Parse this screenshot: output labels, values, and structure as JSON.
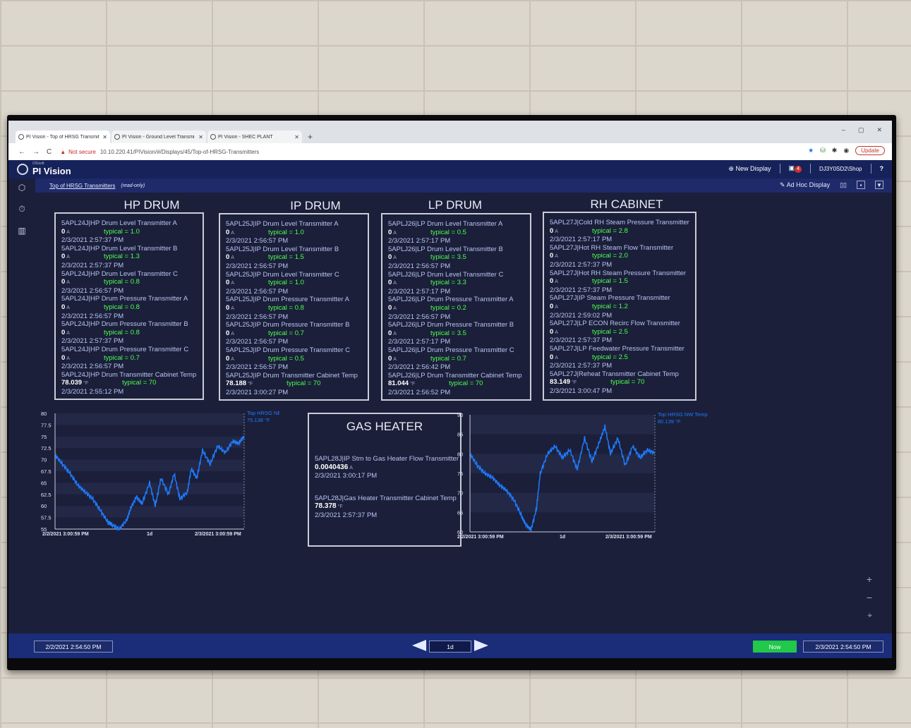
{
  "browser": {
    "tabs": [
      {
        "label": "PI Vision - Top of HRSG Transmit"
      },
      {
        "label": "PI Vision - Ground Level Transmi"
      },
      {
        "label": "PI Vision - SHEC PLANT"
      }
    ],
    "new_tab": "+",
    "warning": "Not secure",
    "url": "10.10.220.41/PIVision/#/Displays/45/Top-of-HRSG-Transmitters",
    "update_label": "Update"
  },
  "app": {
    "vendor": "OSIsoft",
    "name": "PI Vision",
    "new_display": "New Display",
    "notification_count": "4",
    "user": "DJ3Y0SD2\\Shop",
    "help": "?"
  },
  "subheader": {
    "display_name": "Top of HRSG Transmitters",
    "mode": "(read-only)",
    "adhoc": "Ad Hoc Display"
  },
  "sections": [
    {
      "title": "HP DRUM",
      "items": [
        {
          "name": "5APL24J|HP Drum Level Transmitter A",
          "value": "0",
          "unit": "A",
          "typical": "typical = 1.0",
          "time": "2/3/2021 2:57:37 PM"
        },
        {
          "name": "5APL24J|HP Drum Level Transmitter B",
          "value": "0",
          "unit": "A",
          "typical": "typical = 1.3",
          "time": "2/3/2021 2:57:37 PM"
        },
        {
          "name": "5APL24J|HP Drum Level Transmitter C",
          "value": "0",
          "unit": "A",
          "typical": "typical = 0.8",
          "time": "2/3/2021 2:56:57 PM"
        },
        {
          "name": "5APL24J|HP Drum Pressure Transmitter A",
          "value": "0",
          "unit": "A",
          "typical": "typical = 0.8",
          "time": "2/3/2021 2:56:57 PM"
        },
        {
          "name": "5APL24J|HP Drum Pressure Transmitter B",
          "value": "0",
          "unit": "A",
          "typical": "typical = 0.8",
          "time": "2/3/2021 2:57:37 PM"
        },
        {
          "name": "5APL24J|HP Drum Pressure Transmitter C",
          "value": "0",
          "unit": "A",
          "typical": "typical = 0.7",
          "time": "2/3/2021 2:56:57 PM"
        },
        {
          "name": "5APL24J|HP Drum Transmitter Cabinet Temp",
          "value": "78.039",
          "unit": "°F",
          "typical": "typical = 70",
          "time": "2/3/2021 2:55:12 PM"
        }
      ]
    },
    {
      "title": "IP DRUM",
      "items": [
        {
          "name": "5APL25J|IP Drum Level Transmitter A",
          "value": "0",
          "unit": "A",
          "typical": "typical = 1.0",
          "time": "2/3/2021 2:56:57 PM"
        },
        {
          "name": "5APL25J|IP Drum Level Transmitter B",
          "value": "0",
          "unit": "A",
          "typical": "typical = 1.5",
          "time": "2/3/2021 2:56:57 PM"
        },
        {
          "name": "5APL25J|IP Drum Level Transmitter C",
          "value": "0",
          "unit": "A",
          "typical": "typical = 1.0",
          "time": "2/3/2021 2:56:57 PM"
        },
        {
          "name": "5APL25J|IP Drum Pressure Transmitter A",
          "value": "0",
          "unit": "A",
          "typical": "typical = 0.8",
          "time": "2/3/2021 2:56:57 PM"
        },
        {
          "name": "5APL25J|IP Drum Pressure Transmitter B",
          "value": "0",
          "unit": "A",
          "typical": "typical = 0.7",
          "time": "2/3/2021 2:56:57 PM"
        },
        {
          "name": "5APL25J|IP Drum Pressure Transmitter C",
          "value": "0",
          "unit": "A",
          "typical": "typical = 0.5",
          "time": "2/3/2021 2:56:57 PM"
        },
        {
          "name": "5APL25J|IP Drum Transmitter Cabinet Temp",
          "value": "78.188",
          "unit": "°F",
          "typical": "typical = 70",
          "time": "2/3/2021 3:00:27 PM"
        }
      ]
    },
    {
      "title": "LP DRUM",
      "items": [
        {
          "name": "5APLJ26|LP Drum Level Transmitter A",
          "value": "0",
          "unit": "A",
          "typical": "typical = 0.5",
          "time": "2/3/2021 2:57:17 PM"
        },
        {
          "name": "5APLJ26|LP Drum Level Transmitter B",
          "value": "0",
          "unit": "A",
          "typical": "typical = 3.5",
          "time": "2/3/2021 2:56:57 PM"
        },
        {
          "name": "5APLJ26|LP Drum Level Transmitter C",
          "value": "0",
          "unit": "A",
          "typical": "typical = 3.3",
          "time": "2/3/2021 2:57:17 PM"
        },
        {
          "name": "5APLJ26|LP Drum Pressure Transmitter A",
          "value": "0",
          "unit": "A",
          "typical": "typical = 0.2",
          "time": "2/3/2021 2:56:57 PM"
        },
        {
          "name": "5APLJ26|LP Drum Pressure Transmitter B",
          "value": "0",
          "unit": "A",
          "typical": "typical = 3.5",
          "time": "2/3/2021 2:57:17 PM"
        },
        {
          "name": "5APLJ26|LP Drum Pressure Transmitter C",
          "value": "0",
          "unit": "A",
          "typical": "typical = 0.7",
          "time": "2/3/2021 2:56:42 PM"
        },
        {
          "name": "5APLJ26|LP Drum Transmitter Cabinet Temp",
          "value": "81.044",
          "unit": "°F",
          "typical": "typical = 70",
          "time": "2/3/2021 2:56:52 PM"
        }
      ]
    },
    {
      "title": "RH CABINET",
      "items": [
        {
          "name": "5APL27J|Cold RH Steam Pressure Transmitter",
          "value": "0",
          "unit": "A",
          "typical": "typical = 2.8",
          "time": "2/3/2021 2:57:17 PM"
        },
        {
          "name": "5APL27J|Hot RH Steam Flow Transmitter",
          "value": "0",
          "unit": "A",
          "typical": "typical = 2.0",
          "time": "2/3/2021 2:57:37 PM"
        },
        {
          "name": "5APL27J|Hot RH Steam Pressure Transmitter",
          "value": "0",
          "unit": "A",
          "typical": "typical = 1.5",
          "time": "2/3/2021 2:57:37 PM"
        },
        {
          "name": "5APL27J|IP Steam Pressure Transmitter",
          "value": "0",
          "unit": "A",
          "typical": "typical = 1.2",
          "time": "2/3/2021 2:59:02 PM"
        },
        {
          "name": "5APL27J|LP ECON Recirc Flow Transmitter",
          "value": "0",
          "unit": "A",
          "typical": "typical = 2.5",
          "time": "2/3/2021 2:57:37 PM"
        },
        {
          "name": "5APL27J|LP Feedwater Pressure Transmitter",
          "value": "0",
          "unit": "A",
          "typical": "typical = 2.5",
          "time": "2/3/2021 2:57:37 PM"
        },
        {
          "name": "5APL27J|Reheat Transmitter Cabinet Temp",
          "value": "83.149",
          "unit": "°F",
          "typical": "typical = 70",
          "time": "2/3/2021 3:00:47 PM"
        }
      ]
    }
  ],
  "gas_heater": {
    "title": "GAS HEATER",
    "items": [
      {
        "name": "5APL28J|IP Stm to Gas Heater Flow Transmitter",
        "value": "0.0040436",
        "unit": "A",
        "time": "2/3/2021 3:00:17 PM"
      },
      {
        "name": "5APL28J|Gas Heater Transmitter Cabinet Temp",
        "value": "78.378",
        "unit": "°F",
        "time": "2/3/2021 2:57:37 PM"
      }
    ]
  },
  "chart_data": [
    {
      "type": "line",
      "legend": "Top HRSG NE Temp",
      "current": "75.138 °F",
      "color": "#1e7bff",
      "yticks": [
        "80",
        "77.5",
        "75",
        "72.5",
        "70",
        "67.5",
        "65",
        "62.5",
        "60",
        "57.5",
        "55"
      ],
      "ylim": [
        55,
        80
      ],
      "xticks": [
        "2/2/2021 3:00:59 PM",
        "1d",
        "2/3/2021 3:00:59 PM"
      ],
      "x": [
        0,
        0.04,
        0.08,
        0.12,
        0.16,
        0.2,
        0.24,
        0.28,
        0.3,
        0.34,
        0.38,
        0.4,
        0.43,
        0.46,
        0.5,
        0.53,
        0.56,
        0.6,
        0.63,
        0.66,
        0.7,
        0.72,
        0.75,
        0.78,
        0.82,
        0.86,
        0.9,
        0.94,
        0.97,
        1.0
      ],
      "values": [
        71,
        69,
        67,
        64.5,
        63,
        61.5,
        59,
        56.5,
        56,
        55,
        57,
        59.5,
        62,
        60.5,
        65,
        60,
        66,
        62.5,
        67,
        61.5,
        63,
        68,
        66,
        72,
        69,
        73,
        71.5,
        74,
        73.5,
        75.1
      ]
    },
    {
      "type": "line",
      "legend": "Top HRSG NW Temp",
      "current": "80.139 °F",
      "color": "#1e7bff",
      "yticks": [
        "90",
        "85",
        "80",
        "75",
        "70",
        "65",
        "60"
      ],
      "ylim": [
        60,
        90
      ],
      "xticks": [
        "2/2/2021 3:00:59 PM",
        "1d",
        "2/3/2021 3:00:59 PM"
      ],
      "x": [
        0,
        0.04,
        0.08,
        0.12,
        0.16,
        0.2,
        0.24,
        0.28,
        0.3,
        0.33,
        0.36,
        0.38,
        0.42,
        0.46,
        0.5,
        0.54,
        0.58,
        0.62,
        0.66,
        0.7,
        0.73,
        0.76,
        0.8,
        0.84,
        0.88,
        0.92,
        0.96,
        1.0
      ],
      "values": [
        80,
        77,
        75,
        74,
        72,
        70.5,
        68,
        64,
        62,
        60.5,
        66,
        75,
        80,
        82,
        79,
        81,
        76,
        84,
        78,
        83,
        87,
        80,
        84,
        77,
        82,
        79,
        81,
        80.1
      ]
    }
  ],
  "footer": {
    "start_time": "2/2/2021 2:54:50 PM",
    "duration": "1d",
    "now_label": "Now",
    "end_time": "2/3/2021 2:54:50 PM"
  },
  "colors": {
    "display_bg": "#1b1f3a",
    "header_bg": "#16225a",
    "typical_green": "#4cff4c",
    "tag_text": "#b9c4f0",
    "trace": "#1e7bff",
    "now_green": "#21c84a"
  }
}
